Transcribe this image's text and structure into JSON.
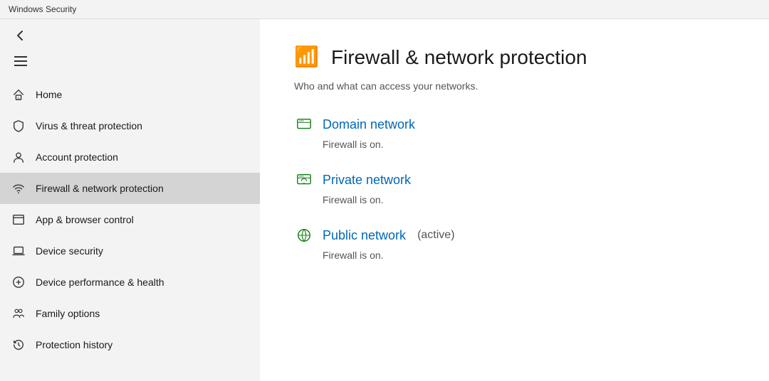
{
  "titleBar": {
    "title": "Windows Security"
  },
  "sidebar": {
    "navItems": [
      {
        "id": "home",
        "label": "Home",
        "icon": "home"
      },
      {
        "id": "virus",
        "label": "Virus & threat protection",
        "icon": "shield"
      },
      {
        "id": "account",
        "label": "Account protection",
        "icon": "person"
      },
      {
        "id": "firewall",
        "label": "Firewall & network protection",
        "icon": "wifi",
        "active": true
      },
      {
        "id": "appbrowser",
        "label": "App & browser control",
        "icon": "appbrowser"
      },
      {
        "id": "devicesecurity",
        "label": "Device security",
        "icon": "laptop"
      },
      {
        "id": "devicehealth",
        "label": "Device performance & health",
        "icon": "heart"
      },
      {
        "id": "family",
        "label": "Family options",
        "icon": "family"
      },
      {
        "id": "history",
        "label": "Protection history",
        "icon": "history"
      }
    ]
  },
  "content": {
    "pageTitle": "Firewall & network protection",
    "pageSubtitle": "Who and what can access your networks.",
    "networks": [
      {
        "id": "domain",
        "name": "Domain network",
        "active": false,
        "activeLabel": "",
        "status": "Firewall is on."
      },
      {
        "id": "private",
        "name": "Private network",
        "active": false,
        "activeLabel": "",
        "status": "Firewall is on."
      },
      {
        "id": "public",
        "name": "Public network",
        "active": true,
        "activeLabel": " (active)",
        "status": "Firewall is on."
      }
    ]
  },
  "icons": {
    "home": "⌂",
    "shield": "🛡",
    "person": "👤",
    "wifi": "📶",
    "appbrowser": "⬜",
    "laptop": "💻",
    "heart": "♡",
    "family": "👨‍👩‍👧",
    "history": "🔄",
    "firewallPage": "📡",
    "domain": "🏢",
    "private": "👥",
    "public": "💬"
  }
}
